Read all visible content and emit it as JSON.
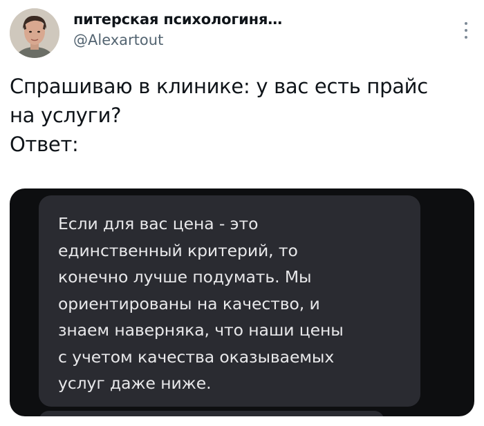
{
  "tweet": {
    "author": {
      "display_name": "питерская психологиня…",
      "handle": "@Alexartout",
      "avatar_icon": "user-avatar"
    },
    "more_icon": "more-options-icon",
    "text_lines": [
      "Спрашиваю в клинике: у вас есть прайс",
      "на услуги?",
      "Ответ:"
    ],
    "media": {
      "message_lines": [
        "Если для вас цена - это",
        "единственный критерий, то",
        "конечно лучше подумать. Мы",
        "ориентированы на качество, и",
        "знаем наверняка, что наши цены",
        "с учетом качества оказываемых",
        "услуг даже ниже."
      ],
      "background_color": "#0d0e10",
      "bubble_color": "#2a2b31"
    }
  }
}
